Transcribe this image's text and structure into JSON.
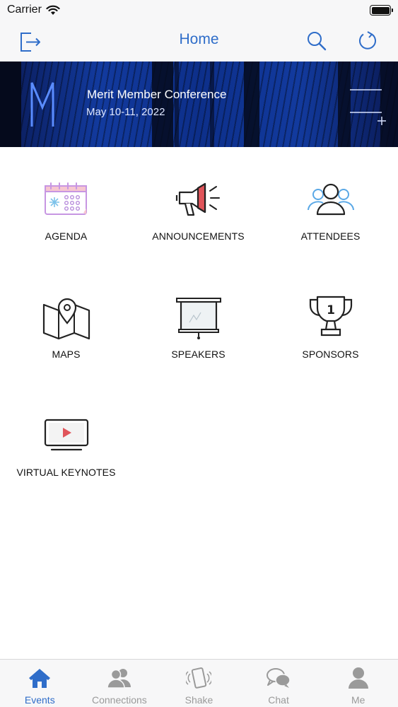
{
  "status_bar": {
    "carrier": "Carrier"
  },
  "nav": {
    "title": "Home"
  },
  "banner": {
    "title": "Merit Member Conference",
    "date": "May 10-11, 2022"
  },
  "tiles": [
    {
      "label": "AGENDA",
      "icon": "calendar-icon"
    },
    {
      "label": "ANNOUNCEMENTS",
      "icon": "megaphone-icon"
    },
    {
      "label": "ATTENDEES",
      "icon": "people-icon"
    },
    {
      "label": "MAPS",
      "icon": "map-pin-icon"
    },
    {
      "label": "SPEAKERS",
      "icon": "projector-screen-icon"
    },
    {
      "label": "SPONSORS",
      "icon": "trophy-icon"
    },
    {
      "label": "VIRTUAL KEYNOTES",
      "icon": "video-player-icon"
    }
  ],
  "tabs": [
    {
      "label": "Events",
      "icon": "home-icon",
      "active": true
    },
    {
      "label": "Connections",
      "icon": "connections-icon",
      "active": false
    },
    {
      "label": "Shake",
      "icon": "shake-phone-icon",
      "active": false
    },
    {
      "label": "Chat",
      "icon": "chat-bubbles-icon",
      "active": false
    },
    {
      "label": "Me",
      "icon": "person-icon",
      "active": false
    }
  ],
  "colors": {
    "accent": "#2f6dc9",
    "inactive_tab": "#9a9a9a",
    "banner_blue": "#123a9e",
    "announcement_red": "#e0545a",
    "attendees_blue": "#5aa8e6"
  }
}
